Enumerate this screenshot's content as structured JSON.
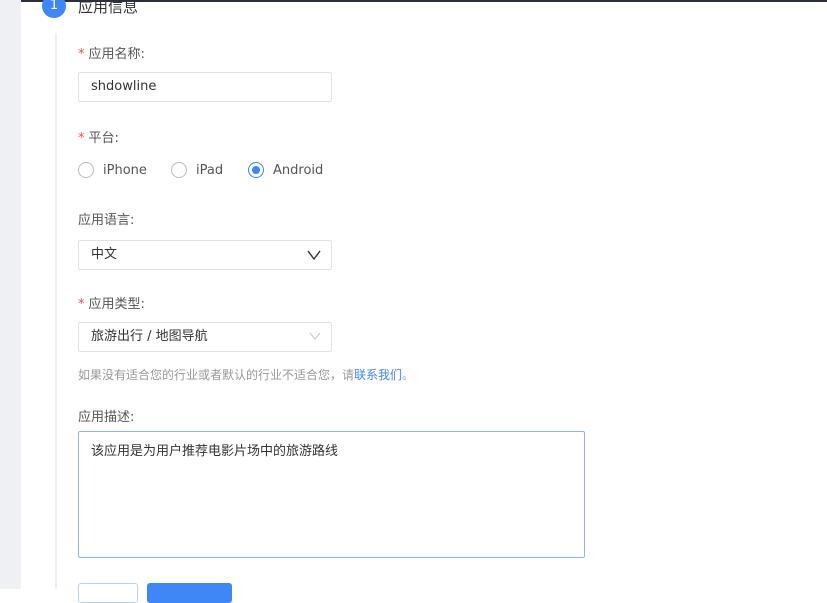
{
  "section": {
    "step": "1",
    "title": "应用信息"
  },
  "form": {
    "name": {
      "label": "应用名称:",
      "required": true,
      "value": "shdowline"
    },
    "platform": {
      "label": "平台:",
      "required": true,
      "options": [
        "iPhone",
        "iPad",
        "Android"
      ],
      "selected": "Android"
    },
    "language": {
      "label": "应用语言:",
      "value": "中文"
    },
    "category": {
      "label": "应用类型:",
      "required": true,
      "value": "旅游出行 / 地图导航"
    },
    "hint": {
      "text": "如果没有适合您的行业或者默认的行业不适合您，请",
      "link": "联系我们",
      "end": "。"
    },
    "description": {
      "label": "应用描述:",
      "value": "该应用是为用户推荐电影片场中的旅游路线"
    }
  },
  "colors": {
    "accent": "#3f86f7",
    "required": "#f04b4b"
  }
}
